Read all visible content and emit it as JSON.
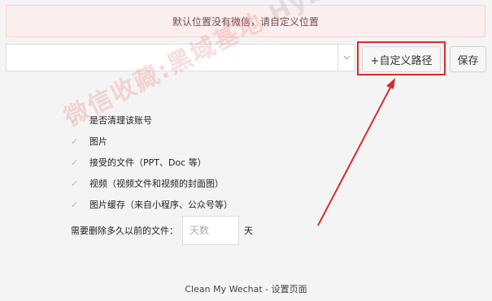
{
  "alert": {
    "text": "默认位置没有微信，请自定义位置"
  },
  "path_select": {
    "value": ""
  },
  "buttons": {
    "custom_path": "+自定义路径",
    "save": "保存"
  },
  "options": [
    {
      "label": "是否清理该账号"
    },
    {
      "label": "图片"
    },
    {
      "label": "接受的文件（PPT、Doc 等）"
    },
    {
      "label": "视频（视频文件和视频的封面图）"
    },
    {
      "label": "图片缓存（来自小程序、公众号等）"
    }
  ],
  "delete_days": {
    "label": "需要删除多久以前的文件：",
    "placeholder": "天数",
    "unit": "天"
  },
  "footer": {
    "text": "Clean My Wechat - 设置页面"
  },
  "watermark": {
    "text_a": "微信收藏:黑域基地",
    "text_b": "Hybase.com"
  },
  "colors": {
    "highlight": "#d62c2c",
    "alert_bg": "#fbeeee"
  }
}
